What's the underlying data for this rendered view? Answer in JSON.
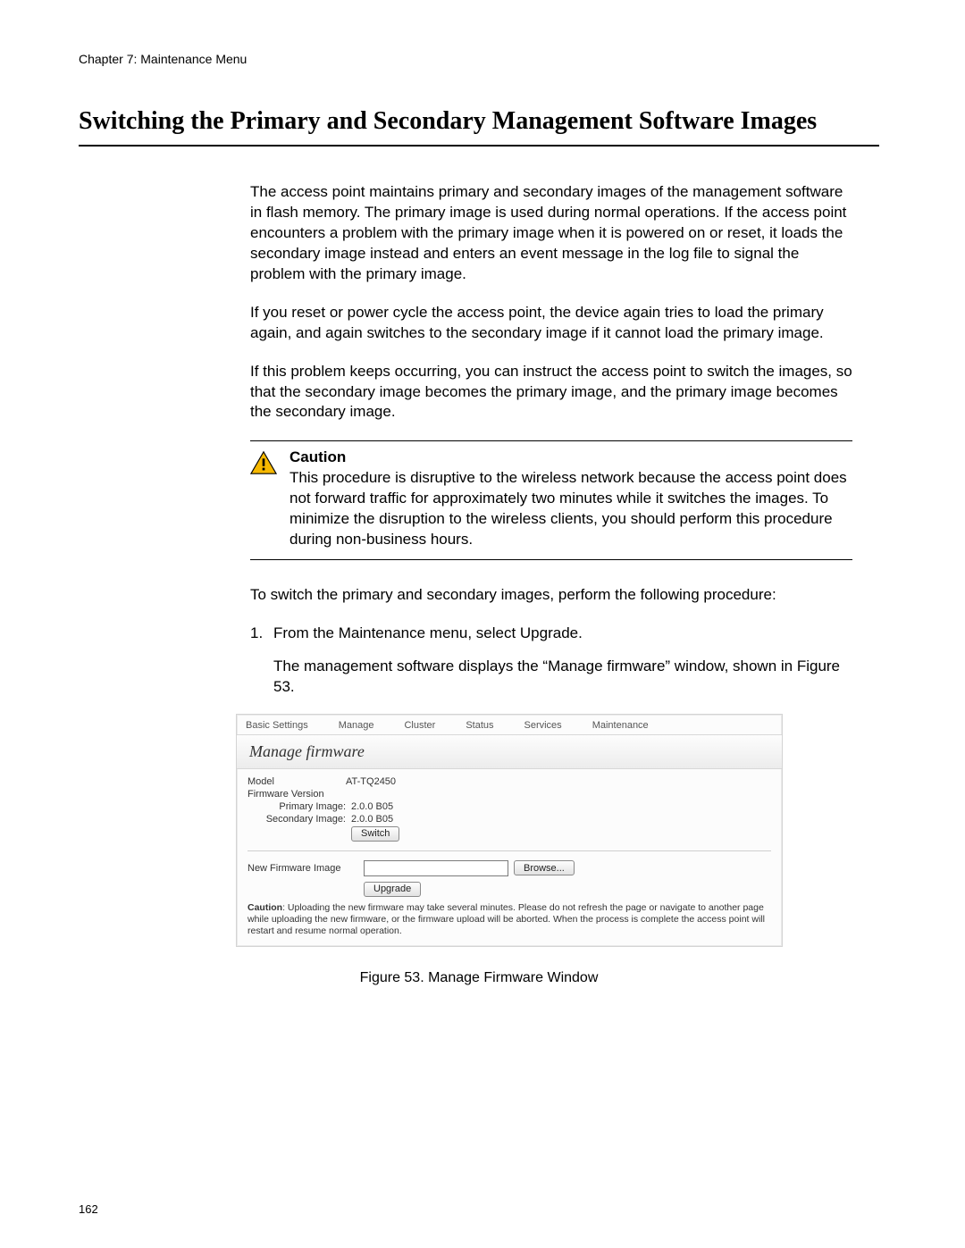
{
  "chapter": "Chapter 7: Maintenance Menu",
  "title": "Switching the Primary and Secondary Management Software Images",
  "paragraphs": {
    "p1": "The access point maintains primary and secondary images of the management software in flash memory. The primary image is used during normal operations. If the access point encounters a problem with the primary image when it is powered on or reset, it loads the secondary image instead and enters an event message in the log file to signal the problem with the primary image.",
    "p2": "If you reset or power cycle the access point, the device again tries to load the primary again, and again switches to the secondary image if it cannot load the primary image.",
    "p3": "If this problem keeps occurring, you can instruct the access point to switch the images, so that the secondary image becomes the primary image, and the primary image becomes the secondary image."
  },
  "caution": {
    "title": "Caution",
    "body": "This procedure is disruptive to the wireless network because the access point does not forward traffic for approximately two minutes while it switches the images. To minimize the disruption to the wireless clients, you should perform this procedure during non-business hours."
  },
  "lead": "To switch the primary and secondary images, perform the following procedure:",
  "step1": {
    "num": "1.",
    "text": "From the Maintenance menu, select Upgrade.",
    "sub": "The management software displays the “Manage firmware” window, shown in Figure 53."
  },
  "figure_caption": "Figure 53. Manage Firmware Window",
  "page_number": "162",
  "fw": {
    "tabs": [
      "Basic Settings",
      "Manage",
      "Cluster",
      "Status",
      "Services",
      "Maintenance"
    ],
    "header": "Manage firmware",
    "model_label": "Model",
    "model_value": "AT-TQ2450",
    "version_label": "Firmware Version",
    "primary_label": "Primary Image:",
    "primary_value": "2.0.0 B05",
    "secondary_label": "Secondary Image:",
    "secondary_value": "2.0.0 B05",
    "switch_btn": "Switch",
    "newimg_label": "New Firmware Image",
    "browse_btn": "Browse...",
    "upgrade_btn": "Upgrade",
    "caution_label": "Caution",
    "caution_text": ": Uploading the new firmware may take several minutes. Please do not refresh the page or navigate to another page while uploading the new firmware, or the firmware upload will be aborted. When the process is complete the access point will restart and resume normal operation."
  }
}
